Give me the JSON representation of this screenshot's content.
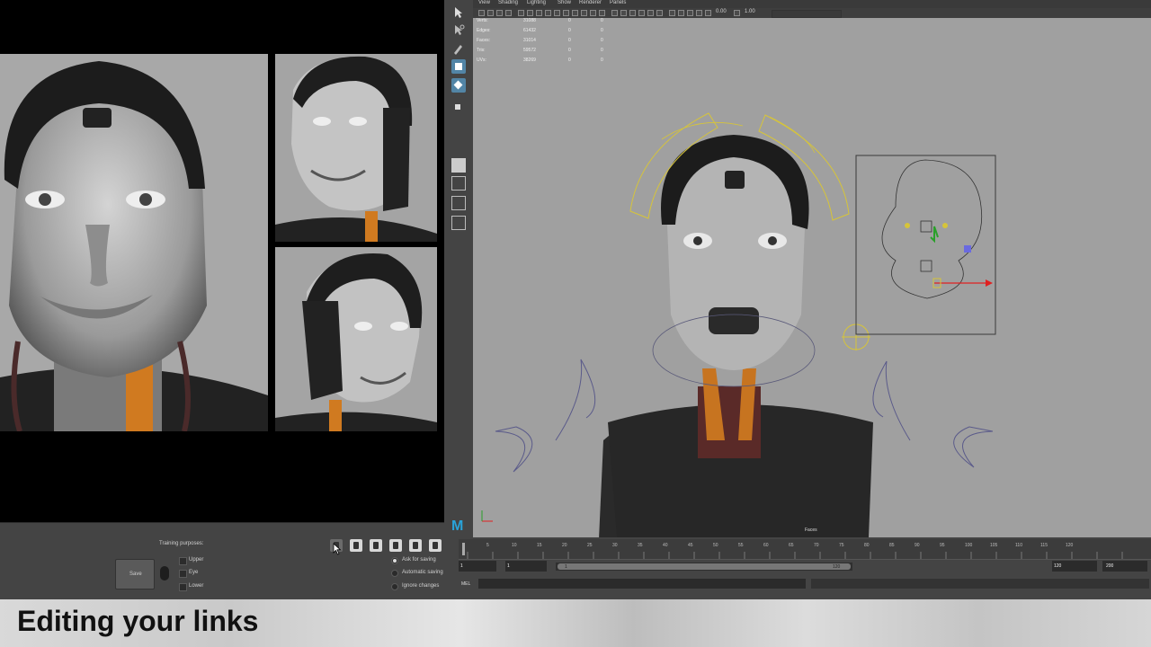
{
  "caption": {
    "text": "Editing your links"
  },
  "tool_window": {
    "training_label": "Training purposes:",
    "save_label": "Save",
    "checkboxes": [
      {
        "label": "Upper"
      },
      {
        "label": "Eye"
      },
      {
        "label": "Lower"
      }
    ],
    "radios": [
      {
        "label": "Ask for saving",
        "selected": true
      },
      {
        "label": "Automatic saving",
        "selected": false
      },
      {
        "label": "Ignore changes",
        "selected": false
      }
    ]
  },
  "maya": {
    "menu": [
      "View",
      "Shading",
      "Lighting",
      "Show",
      "Renderer",
      "Panels"
    ],
    "toolbar": {
      "value1": "0.00",
      "value2": "1.00"
    },
    "hud": {
      "rows": [
        {
          "label": "Verts:",
          "v1": "31088",
          "v2": "0",
          "v3": "0"
        },
        {
          "label": "Edges:",
          "v1": "61432",
          "v2": "0",
          "v3": "0"
        },
        {
          "label": "Faces:",
          "v1": "31014",
          "v2": "0",
          "v3": "0"
        },
        {
          "label": "Tris:",
          "v1": "59572",
          "v2": "0",
          "v3": "0"
        },
        {
          "label": "UVs:",
          "v1": "38269",
          "v2": "0",
          "v3": "0"
        }
      ]
    },
    "viewport_label": "Faces",
    "timeline": {
      "ticks": [
        "1",
        "5",
        "10",
        "15",
        "20",
        "25",
        "30",
        "35",
        "40",
        "45",
        "50",
        "55",
        "60",
        "65",
        "70",
        "75",
        "80",
        "85",
        "90",
        "95",
        "100",
        "105",
        "110",
        "115",
        "120"
      ],
      "range_start": "1",
      "range_start2": "1",
      "range_inner_start": "1",
      "range_inner_end": "120",
      "range_end": "120",
      "range_end2": "200"
    },
    "command_line_label": "MEL"
  }
}
